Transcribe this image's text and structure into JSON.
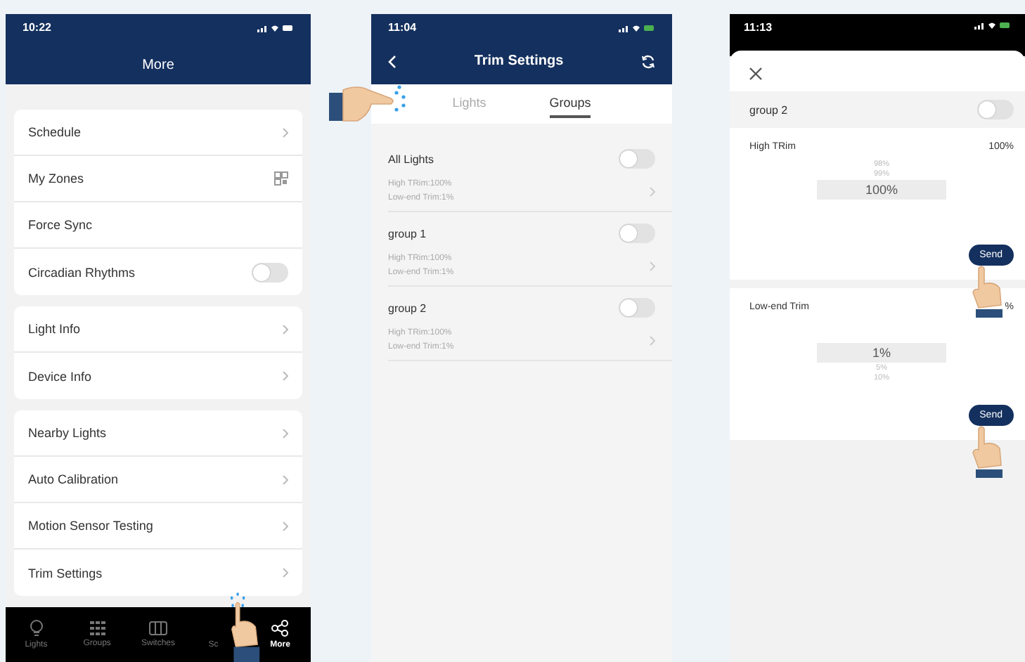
{
  "more_screen": {
    "time": "10:22",
    "title": "More",
    "groups": [
      [
        {
          "label": "Schedule",
          "kind": "chevron"
        },
        {
          "label": "My Zones",
          "kind": "qr"
        },
        {
          "label": "Force Sync",
          "kind": "plain"
        },
        {
          "label": "Circadian Rhythms",
          "kind": "toggle",
          "on": false
        }
      ],
      [
        {
          "label": "Light Info",
          "kind": "chevron"
        },
        {
          "label": "Device Info",
          "kind": "chevron"
        }
      ],
      [
        {
          "label": "Nearby Lights",
          "kind": "chevron"
        },
        {
          "label": "Auto Calibration",
          "kind": "chevron"
        },
        {
          "label": "Motion Sensor Testing",
          "kind": "chevron"
        },
        {
          "label": "Trim Settings",
          "kind": "chevron"
        }
      ]
    ],
    "tab_bar": [
      {
        "label": "Lights",
        "selected": false
      },
      {
        "label": "Groups",
        "selected": false
      },
      {
        "label": "Switches",
        "selected": false
      },
      {
        "label": "Sc",
        "selected": false
      },
      {
        "label": "More",
        "selected": true
      }
    ]
  },
  "trim_settings_screen": {
    "time": "11:04",
    "title": "Trim Settings",
    "tabs": [
      {
        "label": "Lights",
        "selected": false
      },
      {
        "label": "Groups",
        "selected": true
      }
    ],
    "groups": [
      {
        "name": "All Lights",
        "on": false,
        "high_trim": "High TRim:100%",
        "low_trim": "Low-end Trim:1%"
      },
      {
        "name": "group 1",
        "on": false,
        "high_trim": "High TRim:100%",
        "low_trim": "Low-end Trim:1%"
      },
      {
        "name": "group 2",
        "on": false,
        "high_trim": "High TRim:100%",
        "low_trim": "Low-end Trim:1%"
      }
    ]
  },
  "group_trim_screen": {
    "time": "11:13",
    "group": {
      "name": "group 2",
      "on": false
    },
    "sections": [
      {
        "label": "High TRim",
        "value": "100%",
        "options": [
          {
            "label": "98%",
            "selected": false
          },
          {
            "label": "99%",
            "selected": false
          },
          {
            "label": "100%",
            "selected": true
          }
        ],
        "button": "Send"
      },
      {
        "label": "Low-end Trim",
        "value": "%",
        "options": [
          {
            "label": "1%",
            "selected": true
          },
          {
            "label": "5%",
            "selected": false
          },
          {
            "label": "10%",
            "selected": false
          }
        ],
        "button": "Send"
      }
    ]
  }
}
